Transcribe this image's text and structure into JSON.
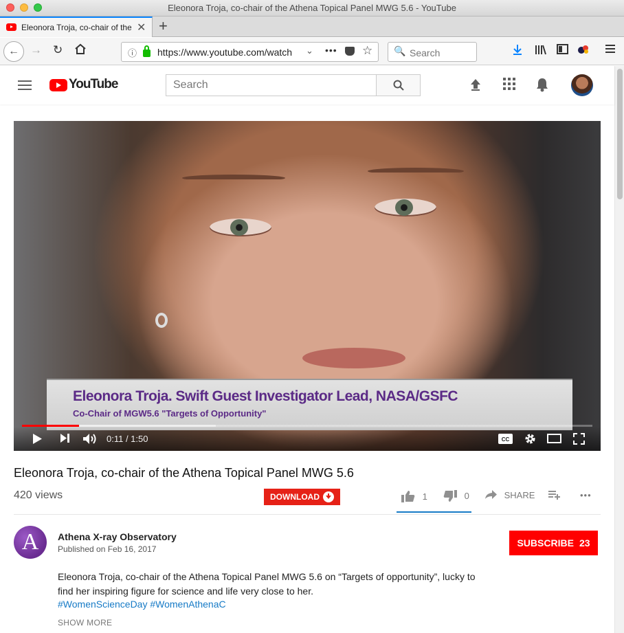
{
  "window": {
    "title": "Eleonora Troja, co-chair of the Athena Topical Panel MWG 5.6 - YouTube"
  },
  "browser": {
    "tab_label": "Eleonora Troja, co-chair of the",
    "new_tab": "+",
    "url": "https://www.youtube.com/watch",
    "search_placeholder": "Search"
  },
  "youtube": {
    "logo_text": "YouTube",
    "search_placeholder": "Search"
  },
  "video": {
    "caption_name": "Eleonora Troja. Swift Guest Investigator Lead, NASA/GSFC",
    "caption_role": "Co-Chair of MGW5.6 \"Targets of Opportunity\"",
    "current_time": "0:11",
    "duration": "1:50",
    "time_display": "0:11 / 1:50",
    "progress_fraction": 0.1,
    "buffered_fraction": 0.34,
    "cc_label": "CC"
  },
  "meta": {
    "title": "Eleonora Troja, co-chair of the Athena Topical Panel MWG 5.6",
    "views": "420 views",
    "download_label": "DOWNLOAD",
    "likes": "1",
    "dislikes": "0",
    "share_label": "SHARE",
    "more": "•••"
  },
  "channel": {
    "avatar_letter": "A",
    "name": "Athena X-ray Observatory",
    "published": "Published on Feb 16, 2017",
    "subscribe_label": "SUBSCRIBE",
    "subscriber_count": "23"
  },
  "description": {
    "text": "Eleonora Troja, co-chair of the Athena Topical Panel MWG 5.6 on “Targets of opportunity”, lucky to find her inspiring figure for science and life very close to her.",
    "hashtags": "#WomenScienceDay #WomenAthenaC",
    "show_more": "SHOW MORE"
  },
  "colors": {
    "youtube_red": "#ff0000",
    "download_red": "#e62117",
    "link_blue": "#167ac6",
    "caption_purple": "#5b2a86"
  }
}
